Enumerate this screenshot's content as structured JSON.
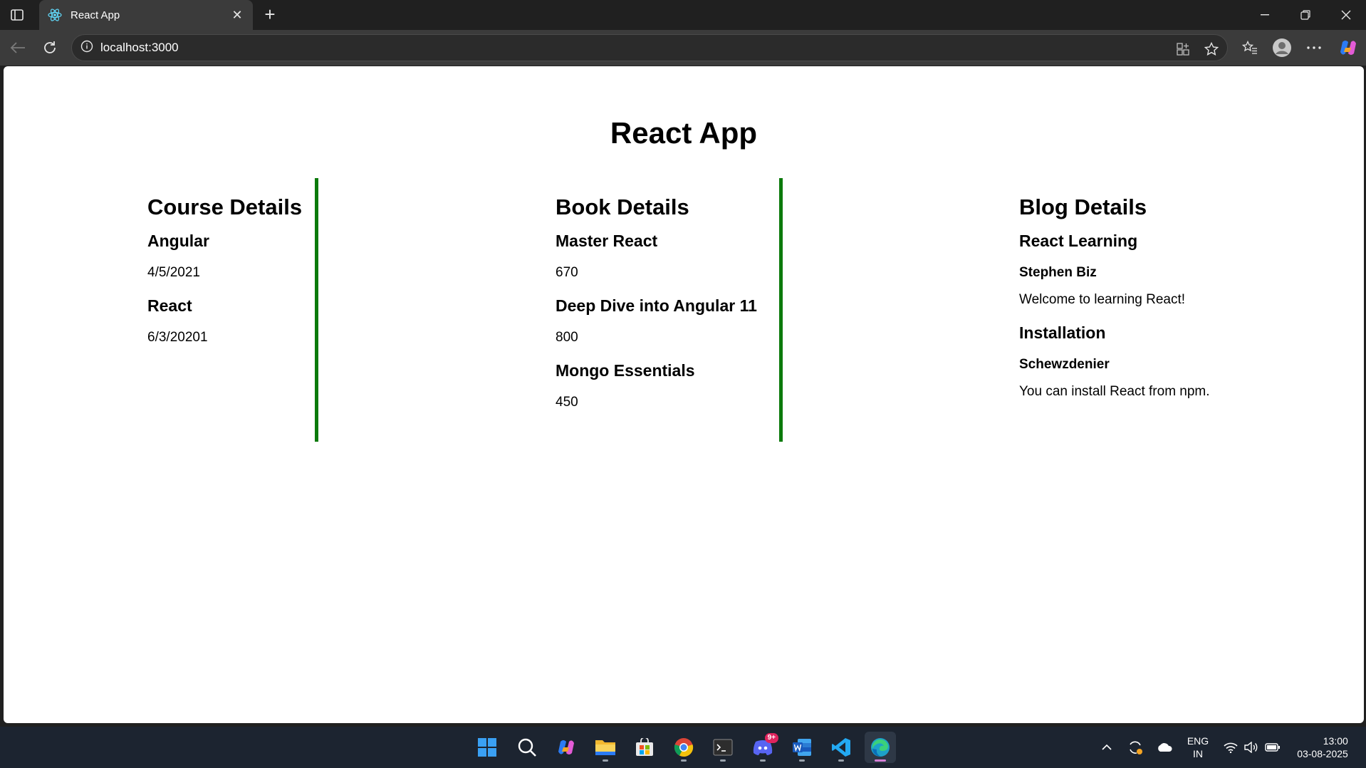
{
  "browser": {
    "tab_title": "React App",
    "url": "localhost:3000"
  },
  "page": {
    "title": "React App",
    "course": {
      "heading": "Course Details",
      "items": [
        {
          "name": "Angular",
          "date": "4/5/2021"
        },
        {
          "name": "React",
          "date": "6/3/20201"
        }
      ]
    },
    "book": {
      "heading": "Book Details",
      "items": [
        {
          "name": "Master React",
          "price": "670"
        },
        {
          "name": "Deep Dive into Angular 11",
          "price": "800"
        },
        {
          "name": "Mongo Essentials",
          "price": "450"
        }
      ]
    },
    "blog": {
      "heading": "Blog Details",
      "items": [
        {
          "title": "React Learning",
          "author": "Stephen Biz",
          "content": "Welcome to learning React!"
        },
        {
          "title": "Installation",
          "author": "Schewzdenier",
          "content": "You can install React from npm."
        }
      ]
    },
    "divider_color": "#0b7a0b"
  },
  "taskbar": {
    "discord_badge": "9+",
    "language": "ENG",
    "region": "IN",
    "time": "13:00",
    "date": "03-08-2025"
  }
}
